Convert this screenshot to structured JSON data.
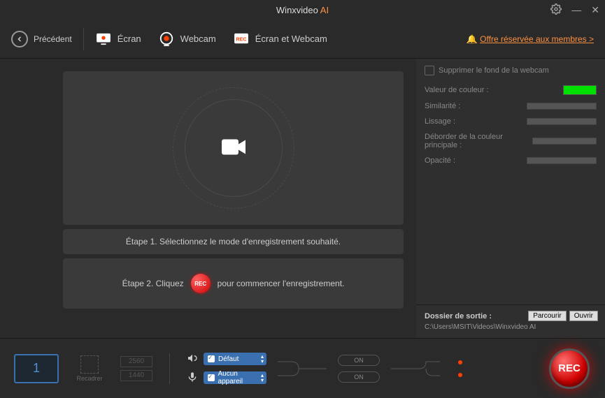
{
  "app": {
    "title_prefix": "Winxvideo",
    "title_suffix": "AI"
  },
  "toolbar": {
    "back": "Précédent",
    "modes": {
      "screen": "Écran",
      "webcam": "Webcam",
      "both": "Écran et Webcam"
    },
    "offer": "Offre réservée aux membres >"
  },
  "side": {
    "remove_bg": "Supprimer le fond de la webcam",
    "color_value": "Valeur de couleur :",
    "similarity": "Similarité :",
    "smoothing": "Lissage :",
    "overflow": "Déborder de la couleur principale :",
    "opacity": "Opacité :"
  },
  "steps": {
    "step1": "Étape 1. Sélectionnez le mode d'enregistrement souhaité.",
    "step2_a": "Étape 2. Cliquez",
    "step2_b": "pour commencer l'enregistrement.",
    "rec_small": "REC"
  },
  "output": {
    "label": "Dossier de sortie :",
    "path": "C:\\Users\\MSIT\\Videos\\Winxvideo AI",
    "browse": "Parcourir",
    "open": "Ouvrir"
  },
  "bottom": {
    "thumb_number": "1",
    "crop": "Recadrer",
    "dim_w": "2560",
    "dim_h": "1440",
    "system_audio": "Défaut",
    "mic": "Aucun appareil",
    "toggle_on": "ON",
    "rec": "REC"
  }
}
